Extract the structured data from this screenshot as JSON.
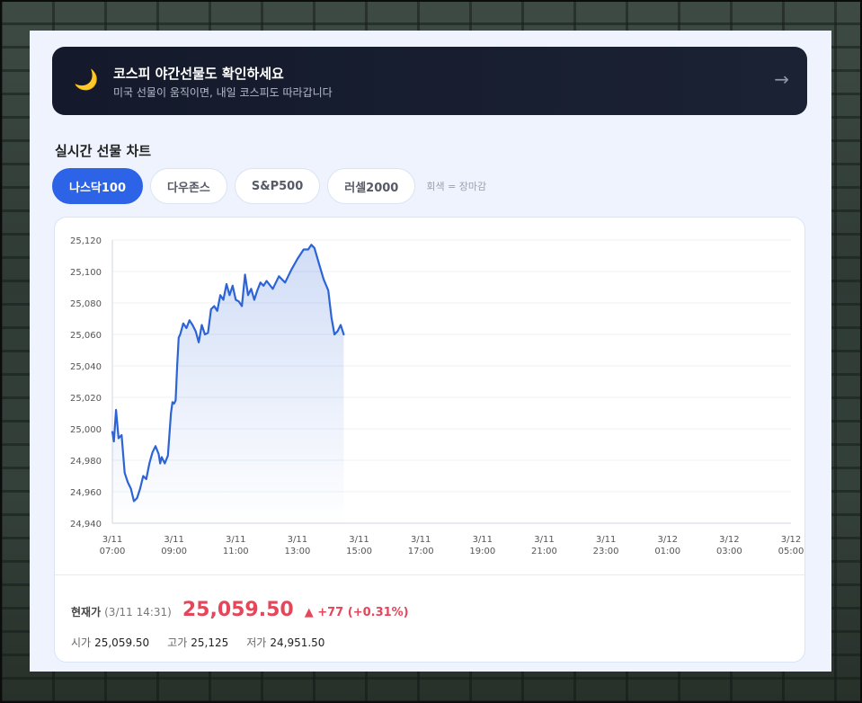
{
  "banner": {
    "icon": "moon-icon",
    "title": "코스피 야간선물도 확인하세요",
    "subtitle": "미국 선물이 움직이면, 내일 코스피도 따라갑니다",
    "arrow": "→"
  },
  "section_title": "실시간 선물 차트",
  "tabs": [
    {
      "label": "나스닥100",
      "active": true
    },
    {
      "label": "다우존스",
      "active": false
    },
    {
      "label": "S&P500",
      "active": false
    },
    {
      "label": "러셀2000",
      "active": false
    }
  ],
  "tab_note": "회색 = 장마감",
  "colors": {
    "accent": "#2d63e6",
    "line": "#2c64d6",
    "up": "#e5465a"
  },
  "chart_data": {
    "type": "area",
    "ylim": [
      24940,
      25120
    ],
    "yticks": [
      "25,120",
      "25,100",
      "25,080",
      "25,060",
      "25,040",
      "25,020",
      "25,000",
      "24,980",
      "24,960",
      "24,940"
    ],
    "ytick_values": [
      25120,
      25100,
      25080,
      25060,
      25040,
      25020,
      25000,
      24980,
      24960,
      24940
    ],
    "xticks": [
      {
        "date": "3/11",
        "time": "07:00"
      },
      {
        "date": "3/11",
        "time": "09:00"
      },
      {
        "date": "3/11",
        "time": "11:00"
      },
      {
        "date": "3/11",
        "time": "13:00"
      },
      {
        "date": "3/11",
        "time": "15:00"
      },
      {
        "date": "3/11",
        "time": "17:00"
      },
      {
        "date": "3/11",
        "time": "19:00"
      },
      {
        "date": "3/11",
        "time": "21:00"
      },
      {
        "date": "3/11",
        "time": "23:00"
      },
      {
        "date": "3/12",
        "time": "01:00"
      },
      {
        "date": "3/12",
        "time": "03:00"
      },
      {
        "date": "3/12",
        "time": "05:00"
      }
    ],
    "xlim_hours": [
      7,
      29
    ],
    "series": [
      {
        "x": [
          7.0,
          7.05,
          7.12,
          7.2,
          7.3,
          7.4,
          7.5,
          7.6,
          7.7,
          7.8,
          7.9,
          8.0,
          8.1,
          8.2,
          8.3,
          8.4,
          8.5,
          8.55,
          8.6,
          8.7,
          8.8,
          8.9,
          8.95,
          9.0,
          9.05,
          9.1,
          9.15,
          9.2,
          9.3,
          9.4,
          9.5,
          9.6,
          9.7,
          9.8,
          9.9,
          10.0,
          10.1,
          10.2,
          10.3,
          10.4,
          10.5,
          10.6,
          10.7,
          10.8,
          10.9,
          11.0,
          11.1,
          11.2,
          11.3,
          11.4,
          11.5,
          11.6,
          11.7,
          11.8,
          11.9,
          12.0,
          12.2,
          12.4,
          12.6,
          12.8,
          13.0,
          13.2,
          13.35,
          13.45,
          13.55,
          13.7,
          13.85,
          14.0,
          14.1,
          14.2,
          14.3,
          14.4,
          14.5
        ],
        "y": [
          24998,
          24992,
          25012,
          24994,
          24996,
          24972,
          24966,
          24962,
          24954,
          24956,
          24962,
          24970,
          24968,
          24978,
          24985,
          24989,
          24984,
          24978,
          24982,
          24978,
          24983,
          25010,
          25017,
          25016,
          25018,
          25040,
          25058,
          25060,
          25067,
          25064,
          25069,
          25066,
          25062,
          25055,
          25066,
          25060,
          25061,
          25076,
          25078,
          25075,
          25085,
          25082,
          25092,
          25085,
          25091,
          25082,
          25081,
          25078,
          25098,
          25085,
          25089,
          25082,
          25088,
          25093,
          25091,
          25094,
          25089,
          25097,
          25093,
          25101,
          25108,
          25114,
          25114,
          25117,
          25115,
          25105,
          25095,
          25088,
          25071,
          25060,
          25062,
          25066,
          25060
        ]
      }
    ]
  },
  "quote": {
    "label": "현재가",
    "time": "(3/11 14:31)",
    "price": "25,059.50",
    "change": "▲ +77 (+0.31%)",
    "stats": [
      {
        "label": "시가",
        "value": "25,059.50"
      },
      {
        "label": "고가",
        "value": "25,125"
      },
      {
        "label": "저가",
        "value": "24,951.50"
      }
    ]
  }
}
